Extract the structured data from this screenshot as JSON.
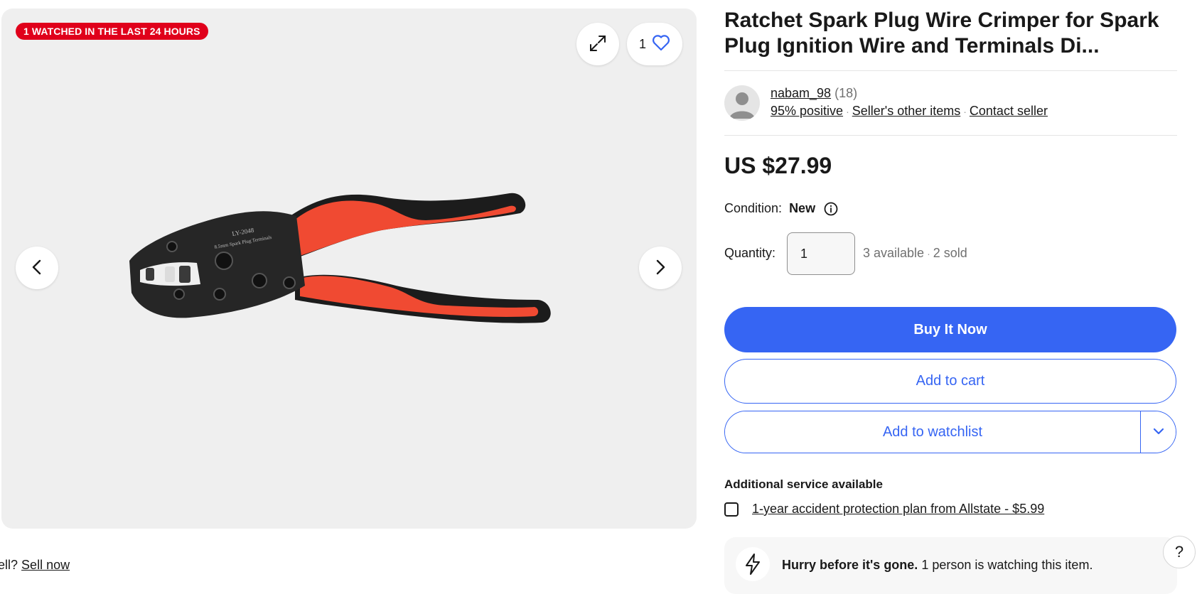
{
  "gallery": {
    "badge": "1 WATCHED IN THE LAST 24 HOURS",
    "watch_count": "1",
    "image_text_line1": "LY-2048",
    "image_text_line2": "8.5mm Spark Plug Terminals"
  },
  "sell_prompt": {
    "prefix": "ell?",
    "link": "Sell now"
  },
  "item": {
    "title": "Ratchet Spark Plug Wire Crimper for Spark Plug Ignition Wire and Terminals Di...",
    "price": "US $27.99",
    "condition_label": "Condition:",
    "condition_value": "New"
  },
  "seller": {
    "name": "nabam_98",
    "feedback_count": "(18)",
    "positive": "95% positive",
    "other_items": "Seller's other items",
    "contact": "Contact seller"
  },
  "quantity": {
    "label": "Quantity:",
    "value": "1",
    "available": "3 available",
    "sold": "2 sold"
  },
  "actions": {
    "buy_now": "Buy It Now",
    "add_to_cart": "Add to cart",
    "add_to_watchlist": "Add to watchlist"
  },
  "additional_service": {
    "heading": "Additional service available",
    "plan": "1-year accident protection plan from Allstate - $5.99"
  },
  "urgency": {
    "strong": "Hurry before it's gone.",
    "text": "1 person is watching this item."
  },
  "help": {
    "label": "?"
  },
  "colors": {
    "primary": "#3665f3",
    "badge": "#e0001b",
    "handle": "#f04a32"
  },
  "icons": [
    "expand-icon",
    "heart-icon",
    "chevron-left-icon",
    "chevron-right-icon",
    "info-icon",
    "chevron-down-icon",
    "lightning-icon"
  ]
}
